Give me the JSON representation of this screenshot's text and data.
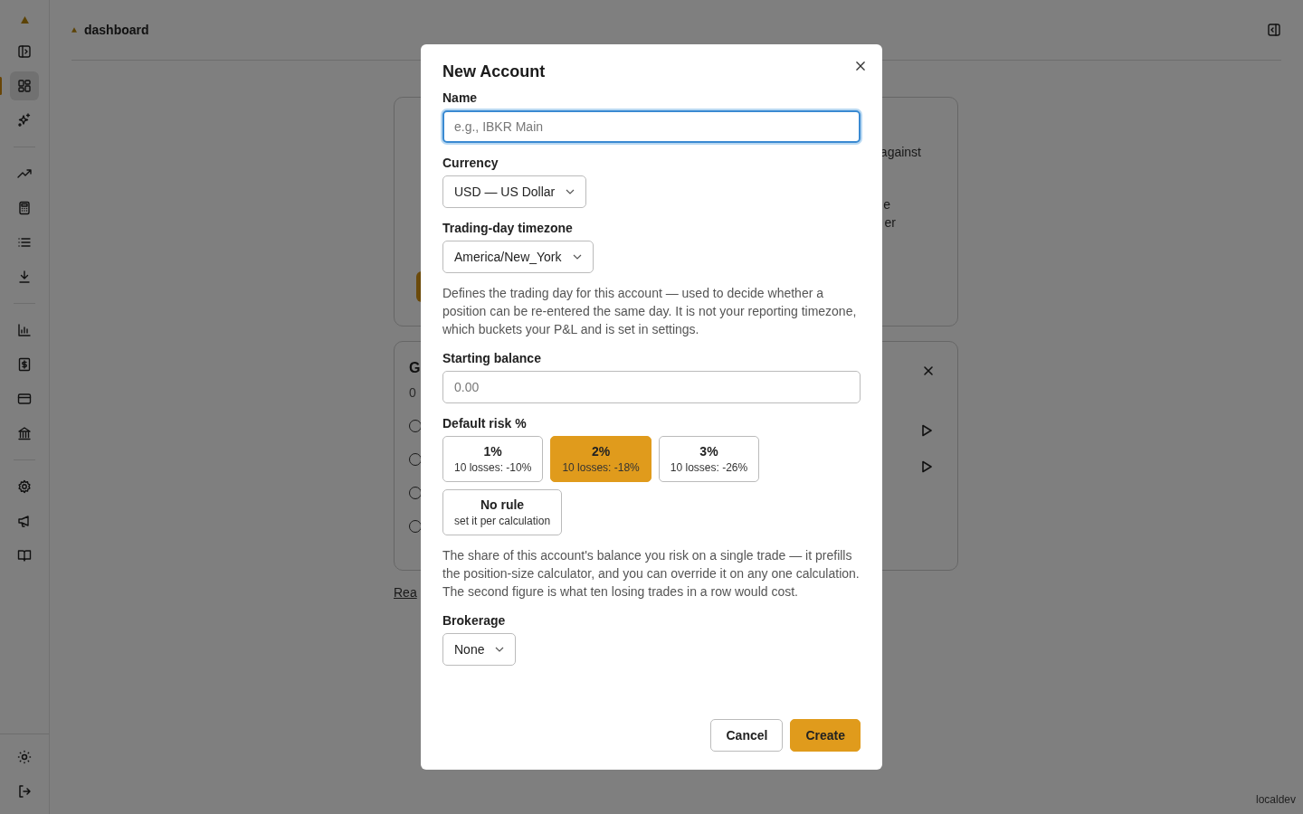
{
  "sidebar": {
    "groups": [
      [
        {
          "selected": false
        },
        {
          "selected": true
        },
        {
          "selected": false
        }
      ],
      [
        {
          "selected": false
        },
        {
          "selected": false
        },
        {
          "selected": false
        },
        {
          "selected": false
        }
      ],
      [
        {
          "selected": false
        },
        {
          "selected": false
        },
        {
          "selected": false
        },
        {
          "selected": false
        }
      ],
      [
        {
          "selected": false
        },
        {
          "selected": false
        },
        {
          "selected": false
        }
      ]
    ]
  },
  "breadcrumb": "dashboard",
  "background": {
    "card_1": {
      "right_lines": [
        "against",
        "e",
        "er"
      ]
    },
    "card_2": {
      "title": "G",
      "subtitle": "0",
      "rows": [
        {
          "playable": true
        },
        {
          "playable": true
        },
        {
          "playable": false
        },
        {
          "playable": false
        }
      ]
    },
    "link": "Rea"
  },
  "dialog": {
    "title": "New Account",
    "fields": [
      {
        "kind": "text",
        "label": "Name",
        "placeholder": "e.g., IBKR Main",
        "focused": true
      },
      {
        "kind": "select",
        "label": "Currency",
        "value": "USD — US Dollar"
      },
      {
        "kind": "select",
        "label": "Trading-day timezone",
        "value": "America/New_York",
        "help": "Defines the trading day for this account — used to decide whether a position can be re-entered the same day. It is not your reporting timezone, which buckets your P&L and is set in settings."
      },
      {
        "kind": "text",
        "label": "Starting balance",
        "placeholder": "0.00",
        "focused": false
      },
      {
        "kind": "options",
        "label": "Default risk %",
        "options": [
          {
            "title": "1%",
            "subtitle": "10 losses: -10%",
            "selected": false
          },
          {
            "title": "2%",
            "subtitle": "10 losses: -18%",
            "selected": true
          },
          {
            "title": "3%",
            "subtitle": "10 losses: -26%",
            "selected": false
          },
          {
            "title": "No rule",
            "subtitle": "set it per calculation",
            "selected": false
          }
        ],
        "help": "The share of this account's balance you risk on a single trade — it prefills the position-size calculator, and you can override it on any one calculation. The second figure is what ten losing trades in a row would cost."
      },
      {
        "kind": "select",
        "label": "Brokerage",
        "value": "None"
      }
    ],
    "buttons": [
      {
        "label": "Cancel",
        "primary": false
      },
      {
        "label": "Create",
        "primary": true
      }
    ]
  },
  "footer": "localdev"
}
